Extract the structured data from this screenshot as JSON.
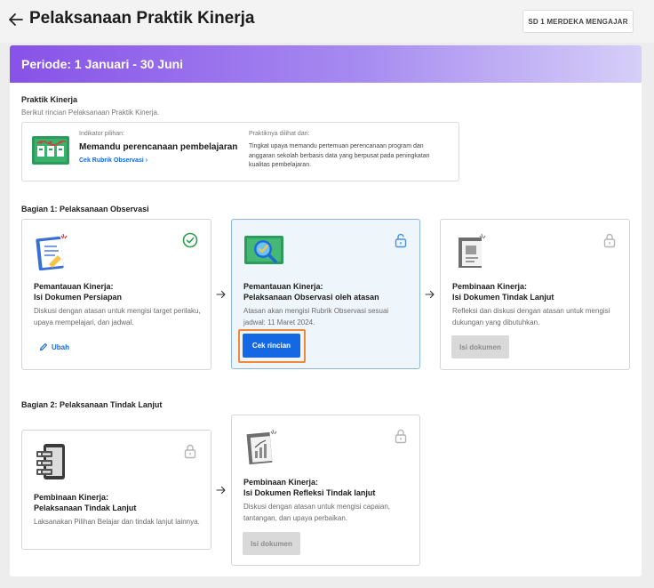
{
  "header": {
    "title": "Pelaksanaan Praktik Kinerja",
    "school_button": "SD 1 MERDEKA MENGAJAR"
  },
  "period": {
    "title": "Periode: 1 Januari - 30 Juni"
  },
  "practice": {
    "title": "Praktik Kinerja",
    "subtitle": "Berikut rincian Pelaksanaan Praktik Kinerja.",
    "indicator_label": "Indikator pilihan:",
    "indicator_value": "Memandu perencanaan pembelajaran",
    "rubric_link": "Cek Rubrik Observasi ›",
    "seen_from_label": "Praktiknya dilihat dari:",
    "seen_from_text": "Tingkat upaya memandu pertemuan perencanaan program dan anggaran sekolah berbasis data yang berpusat pada peningkatan kualitas pembelajaran."
  },
  "section1": {
    "title": "Bagian 1: Pelaksanaan Observasi",
    "cards": [
      {
        "title_line1": "Pemantauan Kinerja:",
        "title_line2": "Isi Dokumen Persiapan",
        "description": "Diskusi dengan atasan untuk mengisi target perilaku, upaya mempelajari, dan jadwal.",
        "action_label": "Ubah",
        "status": "completed"
      },
      {
        "title_line1": "Pemantauan Kinerja:",
        "title_line2": "Pelaksanaan Observasi oleh atasan",
        "description": "Atasan akan mengisi Rubrik Observasi sesuai jadwal: 11 Maret 2024.",
        "action_label": "Cek rincian",
        "status": "unlocked"
      },
      {
        "title_line1": "Pembinaan Kinerja:",
        "title_line2": "Isi Dokumen Tindak Lanjut",
        "description": "Refleksi dan diskusi dengan atasan untuk mengisi dukungan yang dibutuhkan.",
        "action_label": "Isi dokumen",
        "status": "locked"
      }
    ]
  },
  "section2": {
    "title": "Bagian 2: Pelaksanaan Tindak Lanjut",
    "cards": [
      {
        "title_line1": "Pembinaan Kinerja:",
        "title_line2": "Pelaksanaan Tindak Lanjut",
        "description": "Laksanakan Pilihan Belajar dan tindak lanjut lainnya.",
        "status": "locked"
      },
      {
        "title_line1": "Pembinaan Kinerja:",
        "title_line2": "Isi Dokumen Refleksi Tindak lanjut",
        "description": "Diskusi dengan atasan untuk mengisi capaian, tantangan, dan upaya perbaikan.",
        "action_label": "Isi dokumen",
        "status": "locked"
      }
    ]
  },
  "colors": {
    "primary": "#1468e3",
    "success": "#2e9e4f",
    "highlight": "#f2883a",
    "period_gradient_start": "#8752e8",
    "lock": "#b5b5b5"
  }
}
